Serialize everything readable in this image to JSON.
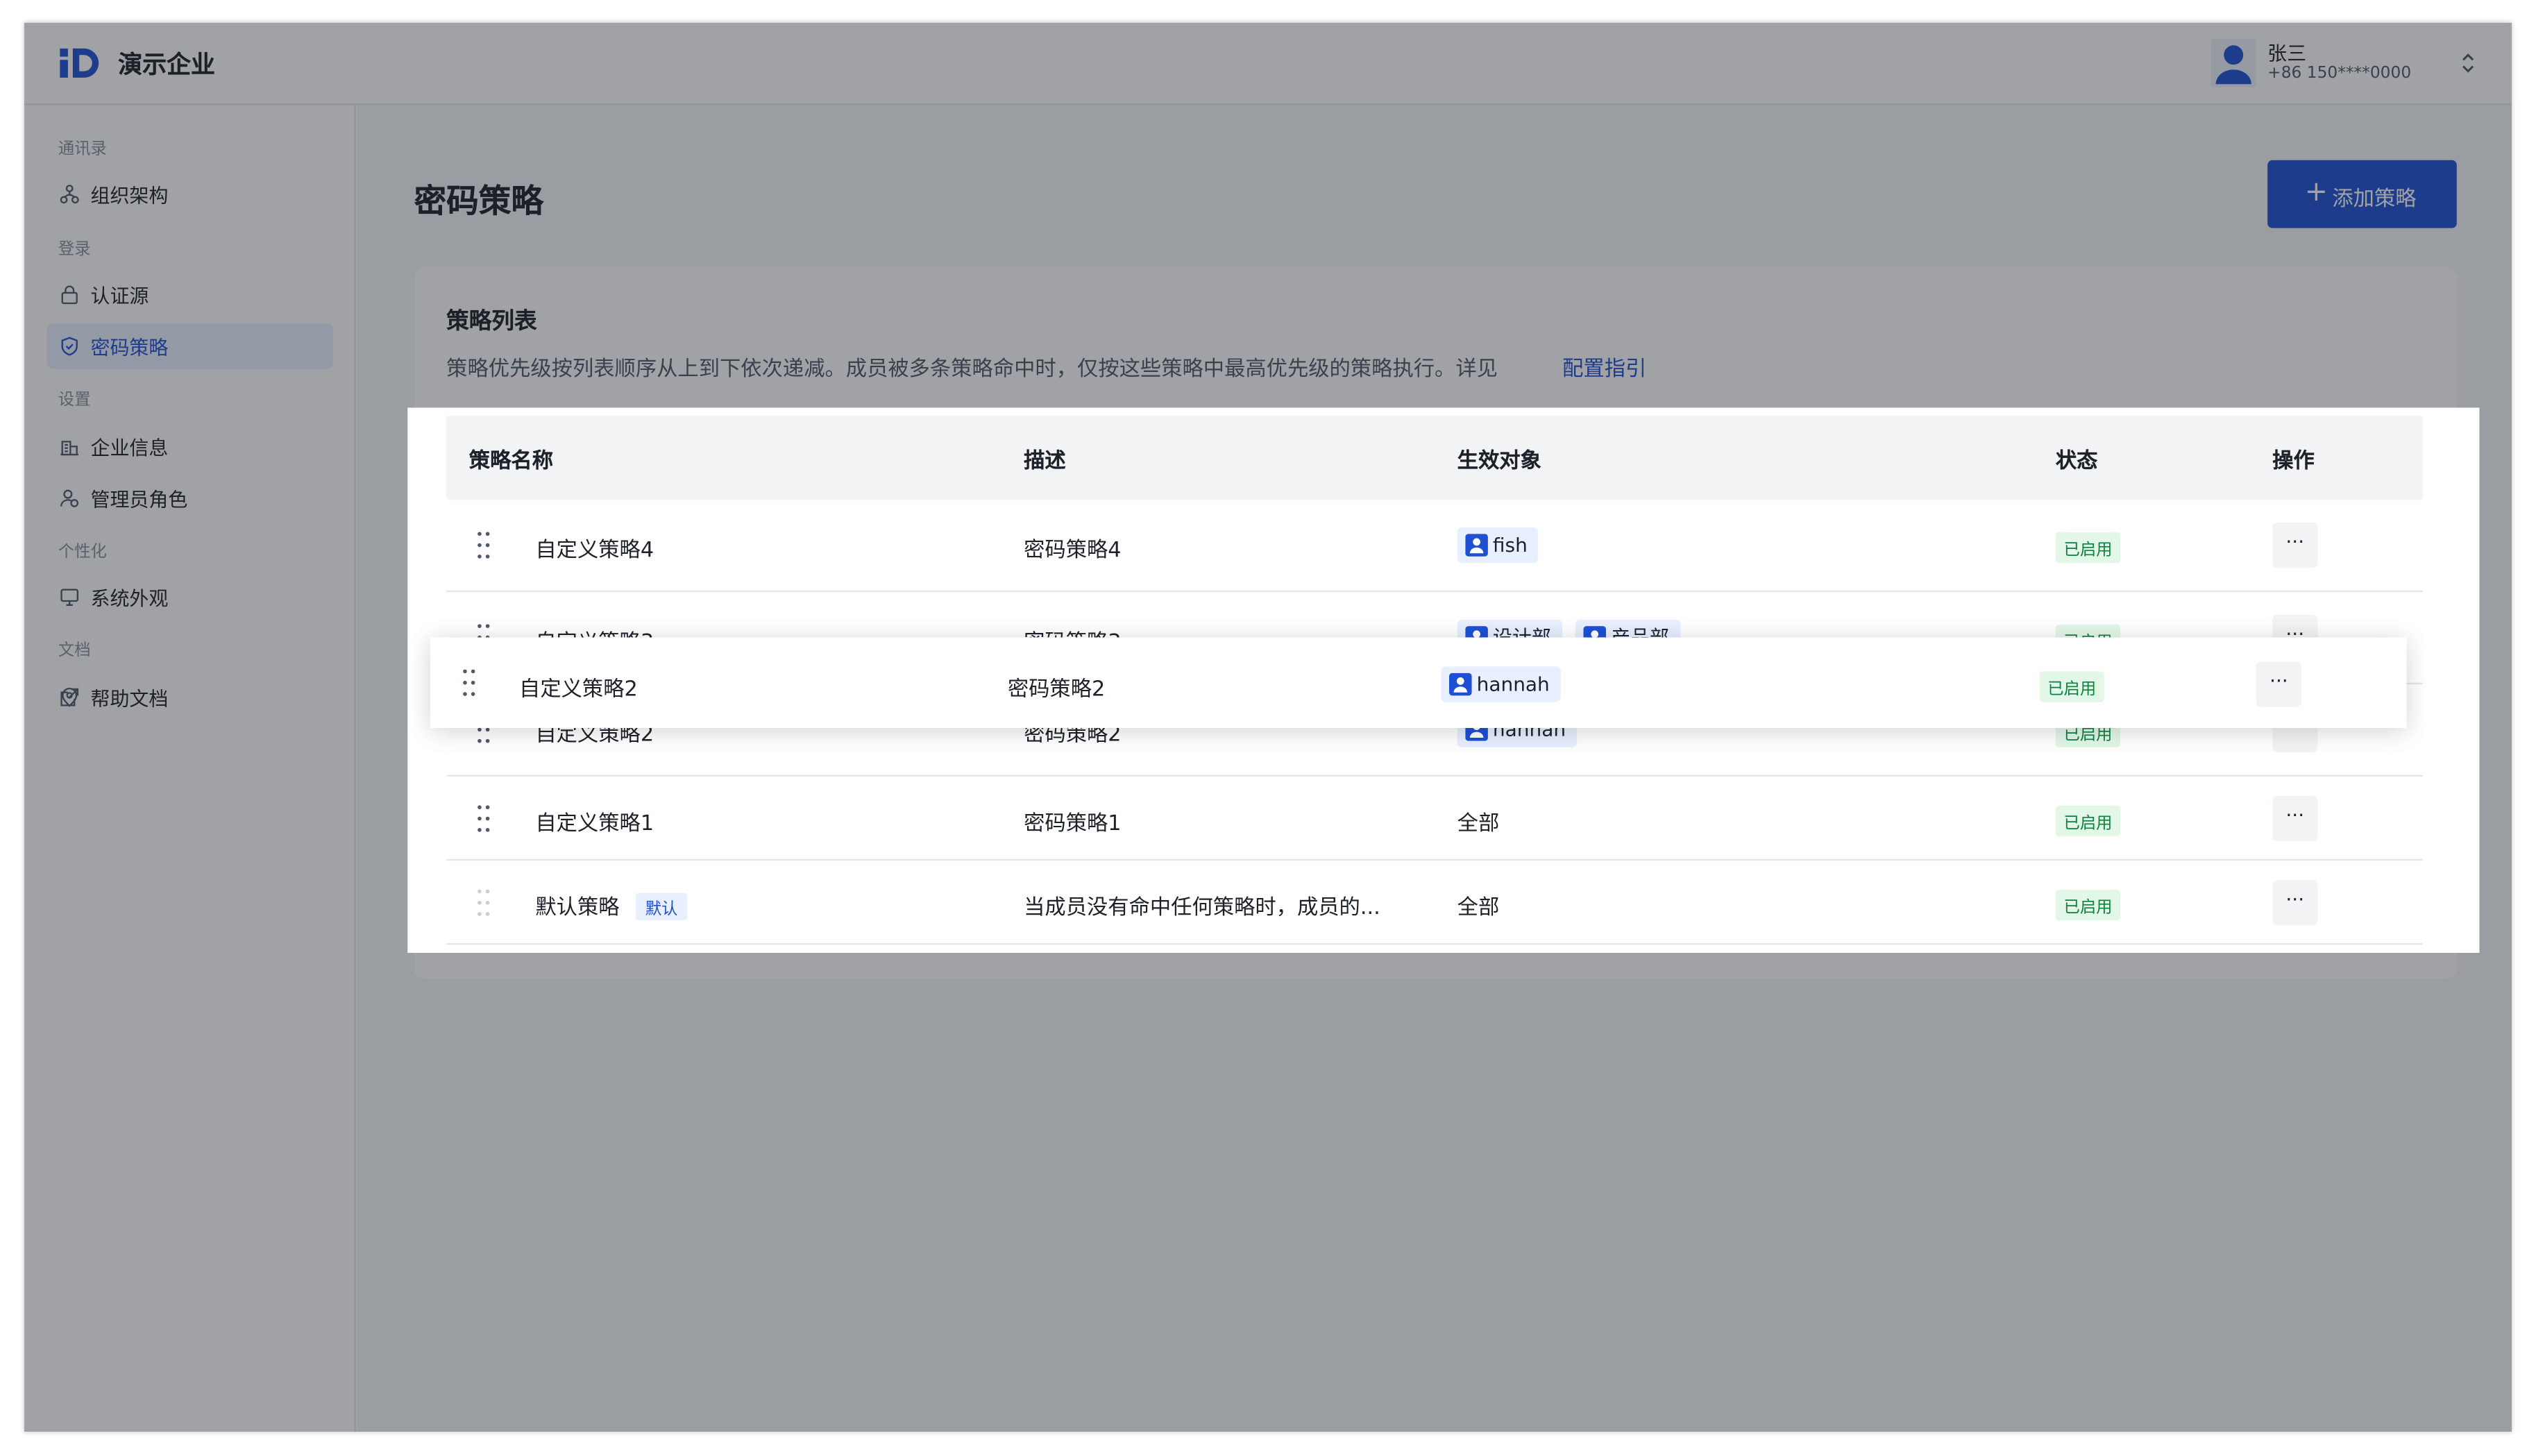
{
  "app": {
    "brand": "演示企业",
    "logo_icon": "id-logo-icon"
  },
  "user": {
    "name": "张三",
    "phone": "+86 150****0000"
  },
  "sidebar": {
    "groups": [
      {
        "label": "通讯录",
        "items": [
          {
            "label": "组织架构",
            "icon": "org-chart-icon"
          }
        ]
      },
      {
        "label": "登录",
        "items": [
          {
            "label": "认证源",
            "icon": "lock-icon"
          },
          {
            "label": "密码策略",
            "icon": "shield-icon",
            "active": true
          }
        ]
      },
      {
        "label": "设置",
        "items": [
          {
            "label": "企业信息",
            "icon": "building-icon"
          },
          {
            "label": "管理员角色",
            "icon": "admin-user-icon"
          }
        ]
      },
      {
        "label": "个性化",
        "items": [
          {
            "label": "系统外观",
            "icon": "monitor-icon"
          }
        ]
      },
      {
        "label": "文档",
        "items": [
          {
            "label": "帮助文档",
            "icon": "help-doc-icon",
            "external": true
          }
        ]
      }
    ]
  },
  "page": {
    "title": "密码策略",
    "add_button": {
      "icon": "+",
      "label": "添加策略"
    }
  },
  "card": {
    "title": "策略列表",
    "description": "策略优先级按列表顺序从上到下依次递减。成员被多条策略命中时，仅按这些策略中最高优先级的策略执行。详见",
    "link": "配置指引"
  },
  "table": {
    "columns": [
      "策略名称",
      "描述",
      "生效对象",
      "状态",
      "操作"
    ],
    "rows": [
      {
        "name": "自定义策略4",
        "desc": "密码策略4",
        "targets": [
          "fish"
        ],
        "status": "已启用",
        "action": "···"
      },
      {
        "name": "自定义策略3",
        "desc": "密码策略3",
        "targets": [
          "设计部",
          "产品部"
        ],
        "status": "已启用",
        "action": "···"
      },
      {
        "name": "自定义策略2",
        "desc": "密码策略2",
        "targets": [
          "hannah"
        ],
        "status": "已启用",
        "action": "···"
      },
      {
        "name": "自定义策略1",
        "desc": "密码策略1",
        "targets_text": "全部",
        "status": "已启用",
        "action": "···"
      },
      {
        "name": "默认策略",
        "badge": "默认",
        "desc": "当成员没有命中任何策略时，成员的...",
        "targets_text": "全部",
        "status": "已启用",
        "action": "···"
      }
    ],
    "dragging_row": {
      "name": "自定义策略2",
      "desc": "密码策略2",
      "target": "hannah",
      "status": "已启用",
      "action": "···"
    }
  },
  "colors": {
    "accent": "#1f50d4",
    "status_green": "#0d8040",
    "overlay": "rgba(29,33,41,0.42)"
  }
}
